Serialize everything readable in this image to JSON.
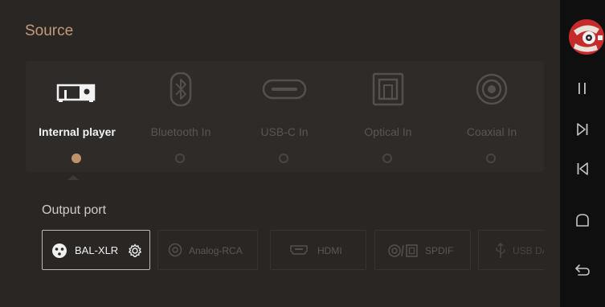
{
  "header": {
    "title": "Source"
  },
  "sources": [
    {
      "label": "Internal player",
      "icon": "internal-player-icon",
      "selected": true
    },
    {
      "label": "Bluetooth In",
      "icon": "bluetooth-icon",
      "selected": false
    },
    {
      "label": "USB-C In",
      "icon": "usb-c-icon",
      "selected": false
    },
    {
      "label": "Optical In",
      "icon": "optical-icon",
      "selected": false
    },
    {
      "label": "Coaxial In",
      "icon": "coaxial-icon",
      "selected": false
    }
  ],
  "output": {
    "title": "Output port",
    "ports": [
      {
        "label": "BAL-XLR",
        "icon": "xlr-icon",
        "active": true,
        "has_settings": true
      },
      {
        "label": "Analog-RCA",
        "icon": "rca-icon",
        "active": false
      },
      {
        "label": "HDMI",
        "icon": "hdmi-icon",
        "active": false
      },
      {
        "label": "SPDIF",
        "icon": "spdif-icon",
        "active": false
      },
      {
        "label": "USB DAC",
        "icon": "usb-icon",
        "active": false
      }
    ]
  },
  "sidebar": {
    "buttons": [
      "play-pause-icon",
      "next-track-icon",
      "previous-track-icon",
      "home-icon",
      "back-icon"
    ]
  },
  "colors": {
    "accent": "#c0926c",
    "title": "#c39a7c",
    "background": "#2a2624",
    "sidebar": "#0f0f0f"
  }
}
